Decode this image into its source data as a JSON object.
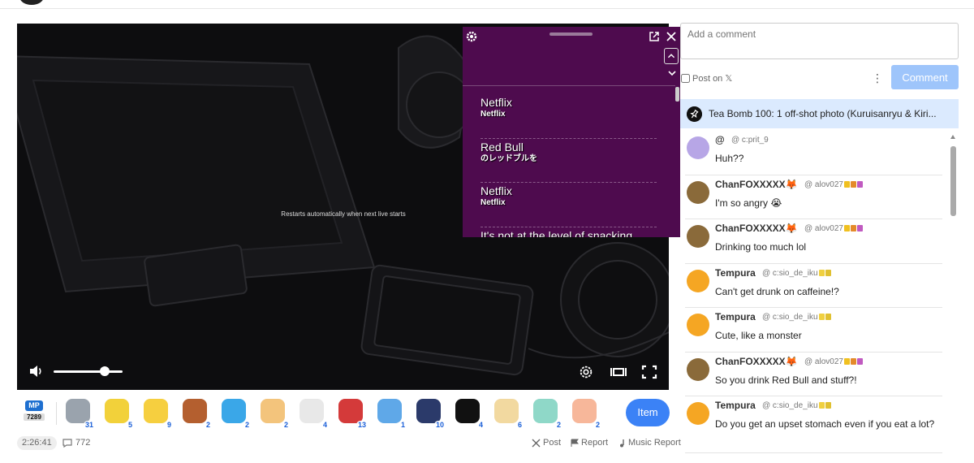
{
  "player": {
    "offline_message": "Restarts automatically when next live starts"
  },
  "overlay": {
    "items": [
      {
        "main": "Netflix",
        "sub": "Netflix"
      },
      {
        "main": "Red Bull",
        "sub": "のレッドブルを"
      },
      {
        "main": "Netflix",
        "sub": "Netflix"
      },
      {
        "main": "It's not at the level of snacking",
        "sub": ""
      }
    ]
  },
  "gifts": {
    "mp_label": "MP",
    "mp_count": "7289",
    "items": [
      {
        "icon": "silver-capsule-icon",
        "count": "31",
        "color": "#9aa3ad"
      },
      {
        "icon": "gold-cup-10-icon",
        "count": "5",
        "color": "#f2d13a"
      },
      {
        "icon": "gold-cup-100-icon",
        "count": "9",
        "color": "#f6cf3f"
      },
      {
        "icon": "cake-icon",
        "count": "2",
        "color": "#b45f2f"
      },
      {
        "icon": "blue-star-icon",
        "count": "2",
        "color": "#3aa7e8"
      },
      {
        "icon": "flower-cup-icon",
        "count": "2",
        "color": "#f3c47c"
      },
      {
        "icon": "sheep-cloud-icon",
        "count": "4",
        "color": "#e8e8e8"
      },
      {
        "icon": "snowman-red-hat-icon",
        "count": "13",
        "color": "#d43a3a"
      },
      {
        "icon": "ghost-blue-icon",
        "count": "1",
        "color": "#5fa8e8"
      },
      {
        "icon": "stage-photo-icon",
        "count": "10",
        "color": "#2b3a6a"
      },
      {
        "icon": "black-card-icon",
        "count": "4",
        "color": "#111111"
      },
      {
        "icon": "pudding-cup-icon",
        "count": "6",
        "color": "#f2d9a0"
      },
      {
        "icon": "rainbow-cat-icon",
        "count": "2",
        "color": "#8fd8c8"
      },
      {
        "icon": "clapping-hands-icon",
        "count": "2",
        "color": "#f7b79a"
      }
    ],
    "item_button": "Item"
  },
  "stats": {
    "elapsed": "2:26:41",
    "comment_count": "772"
  },
  "actions": {
    "post": "Post",
    "report": "Report",
    "music_report": "Music Report"
  },
  "comment_box": {
    "placeholder": "Add a comment",
    "post_on_x": "Post on 𝕏",
    "button": "Comment"
  },
  "pinned": {
    "text": "Tea Bomb 100: 1 off-shot photo (Kuruisanryu & Kiri..."
  },
  "comments": [
    {
      "name": "@",
      "handle": "@ c:prit_9",
      "text": "Huh??",
      "avatar": "#b7a6e6",
      "badges": []
    },
    {
      "name": "ChanFOXXXXX🦊",
      "handle": "@ alov027",
      "text": "I'm so angry 😭",
      "avatar": "#8a6a3a",
      "badges": [
        "#f0c020",
        "#e48a2a",
        "#c05ac0"
      ]
    },
    {
      "name": "ChanFOXXXXX🦊",
      "handle": "@ alov027",
      "text": "Drinking too much lol",
      "avatar": "#8a6a3a",
      "badges": [
        "#f0c020",
        "#e48a2a",
        "#c05ac0"
      ]
    },
    {
      "name": "Tempura",
      "handle": "@ c:sio_de_iku",
      "text": "Can't get drunk on caffeine!?",
      "avatar": "#f5a623",
      "badges": [
        "#f0d040",
        "#e0c030"
      ]
    },
    {
      "name": "Tempura",
      "handle": "@ c:sio_de_iku",
      "text": "Cute, like a monster",
      "avatar": "#f5a623",
      "badges": [
        "#f0d040",
        "#e0c030"
      ]
    },
    {
      "name": "ChanFOXXXXX🦊",
      "handle": "@ alov027",
      "text": "So you drink Red Bull and stuff?!",
      "avatar": "#8a6a3a",
      "badges": [
        "#f0c020",
        "#e48a2a",
        "#c05ac0"
      ]
    },
    {
      "name": "Tempura",
      "handle": "@ c:sio_de_iku",
      "text": "Do you get an upset stomach even if you eat a lot?",
      "avatar": "#f5a623",
      "badges": [
        "#f0d040",
        "#e0c030"
      ]
    }
  ]
}
